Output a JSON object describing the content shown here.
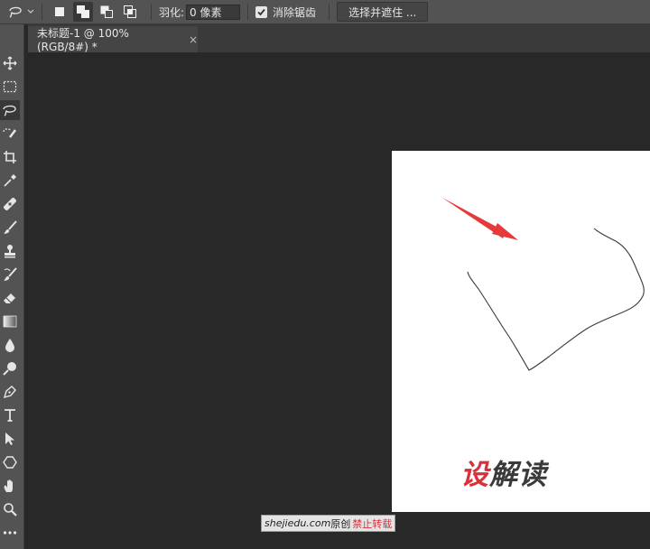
{
  "options_bar": {
    "feather_label": "羽化:",
    "feather_value": "0 像素",
    "antialias_label": "消除锯齿",
    "antialias_checked": true,
    "select_mask_label": "选择并遮住 ..."
  },
  "document_tab": {
    "title": "未标题-1 @ 100%(RGB/8#) *",
    "close_glyph": "×"
  },
  "watermark": {
    "logo_red": "设",
    "logo_rest": "解读",
    "caption_site": "shejiedu.com",
    "caption_text": "原创",
    "caption_warning": "禁止转载"
  },
  "colors": {
    "panel": "#535353",
    "canvas_bg": "#282828",
    "document": "#ffffff",
    "arrow": "#e5393a",
    "accent_red": "#d8313a"
  },
  "tools": [
    "move-icon",
    "marquee-icon",
    "lasso-icon",
    "quick-select-icon",
    "crop-icon",
    "eyedropper-icon",
    "healing-icon",
    "brush-icon",
    "stamp-icon",
    "history-brush-icon",
    "eraser-icon",
    "gradient-icon",
    "blur-icon",
    "dodge-icon",
    "pen-icon",
    "type-icon",
    "path-select-icon",
    "shape-icon",
    "hand-icon",
    "zoom-icon",
    "more-icon"
  ]
}
